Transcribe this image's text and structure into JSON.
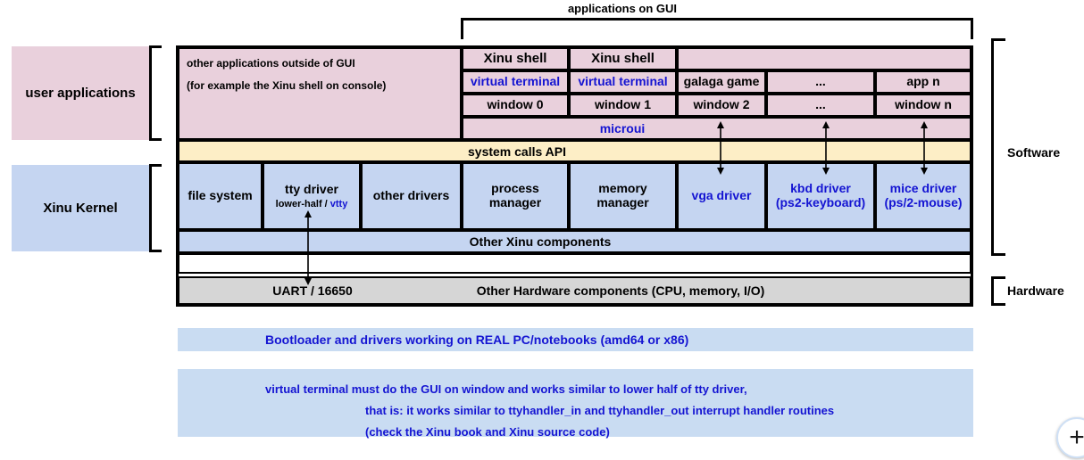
{
  "diagram": {
    "top_caption": "applications on GUI",
    "left_groups": [
      {
        "label": "user applications"
      },
      {
        "label": "Xinu Kernel"
      }
    ],
    "right_groups": [
      {
        "label": "Software"
      },
      {
        "label": "Hardware"
      }
    ],
    "outside_gui": {
      "line1": "other applications outside of GUI",
      "line2": "(for example the Xinu shell on console)"
    },
    "app_columns": [
      {
        "top": "Xinu shell",
        "mid": "virtual terminal",
        "bottom": "window 0"
      },
      {
        "top": "Xinu shell",
        "mid": "virtual terminal",
        "bottom": "window 1"
      },
      {
        "top": "",
        "mid": "galaga game",
        "bottom": "window 2"
      },
      {
        "top": "",
        "mid": "...",
        "bottom": "..."
      },
      {
        "top": "",
        "mid": "app n",
        "bottom": "window n"
      }
    ],
    "microui_label": "microui",
    "syscalls_label": "system calls API",
    "kernel_boxes": [
      {
        "title": "file system",
        "sub": "",
        "sub_plain": "",
        "color": "black"
      },
      {
        "title": "tty driver",
        "sub_plain": "lower-half / ",
        "sub_blue": "vtty",
        "color": "black"
      },
      {
        "title": "other drivers",
        "sub": "",
        "color": "black"
      },
      {
        "title": "process\nmanager",
        "sub": "",
        "color": "black"
      },
      {
        "title": "memory\nmanager",
        "sub": "",
        "color": "black"
      },
      {
        "title": "vga driver",
        "sub": "",
        "color": "blue"
      },
      {
        "title": "kbd  driver\n(ps2-keyboard)",
        "sub": "",
        "color": "blue"
      },
      {
        "title": "mice driver\n(ps/2-mouse)",
        "sub": "",
        "color": "blue"
      }
    ],
    "other_xinu_label": "Other Xinu components",
    "hardware_uart_label": "UART / 16650",
    "hardware_other_label": "Other Hardware components (CPU, memory, I/O)",
    "bootloader_note": "Bootloader and drivers working on REAL PC/notebooks (amd64 or x86)",
    "vterm_notes": [
      "virtual terminal must do the GUI on window and works similar to lower half of tty driver,",
      "that is: it works similar to ttyhandler_in and ttyhandler_out interrupt handler routines",
      "(check the Xinu book and Xinu source code)"
    ]
  },
  "controls": {
    "zoom_in_label": "+"
  },
  "colors": {
    "pink": "#e9d0dc",
    "blue": "#c5d5f1",
    "yellow": "#fdeec6",
    "grey": "#d6d6d6",
    "accent_text": "#1414d2"
  }
}
